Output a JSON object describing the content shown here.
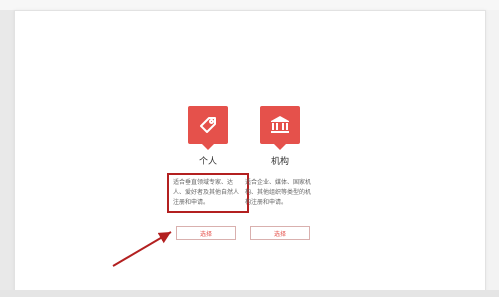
{
  "options": [
    {
      "id": "personal",
      "title": "个人",
      "description": "适合垂直领域专家、达人、爱好者及其他自然人注册和申请。",
      "button": "选择",
      "icon": "tag-icon"
    },
    {
      "id": "organization",
      "title": "机构",
      "description": "适合企业、媒体、国家机构、其他组织等类型的机构注册和申请。",
      "button": "选择",
      "icon": "bank-icon"
    }
  ],
  "colors": {
    "accent": "#e5514b",
    "highlight_border": "#b32020",
    "arrow": "#b32020"
  }
}
